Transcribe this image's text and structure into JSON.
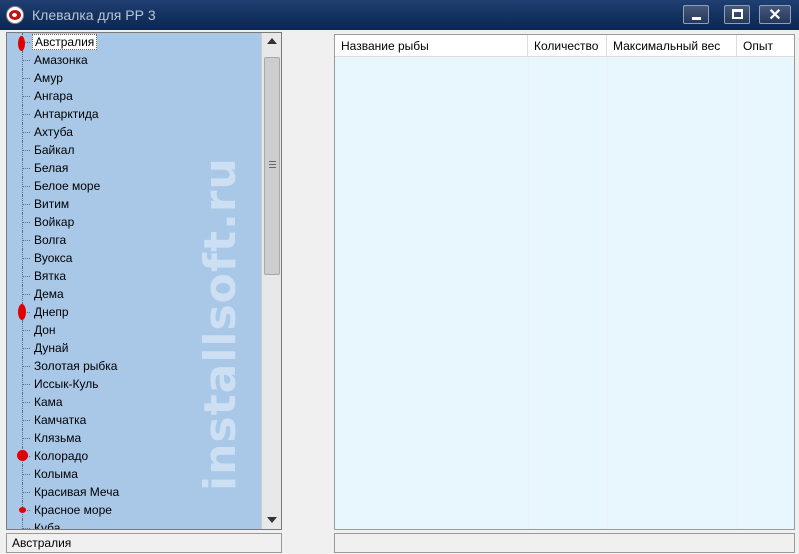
{
  "window": {
    "title": "Клевалка для РР 3",
    "icon": "yin-yang-app-icon",
    "controls": [
      "minimize-icon",
      "maximize-icon",
      "close-icon"
    ],
    "close_glyph": "✕"
  },
  "tree": {
    "selected": "Австралия",
    "items": [
      {
        "label": "Австралия",
        "marked": true
      },
      {
        "label": "Амазонка",
        "marked": false
      },
      {
        "label": "Амур",
        "marked": false
      },
      {
        "label": "Ангара",
        "marked": false
      },
      {
        "label": "Антарктида",
        "marked": false
      },
      {
        "label": "Ахтуба",
        "marked": false
      },
      {
        "label": "Байкал",
        "marked": false
      },
      {
        "label": "Белая",
        "marked": false
      },
      {
        "label": "Белое море",
        "marked": false
      },
      {
        "label": "Витим",
        "marked": false
      },
      {
        "label": "Войкар",
        "marked": false
      },
      {
        "label": "Волга",
        "marked": false
      },
      {
        "label": "Вуокса",
        "marked": false
      },
      {
        "label": "Вятка",
        "marked": false
      },
      {
        "label": "Дема",
        "marked": false
      },
      {
        "label": "Днепр",
        "marked": true
      },
      {
        "label": "Дон",
        "marked": false
      },
      {
        "label": "Дунай",
        "marked": false
      },
      {
        "label": "Золотая рыбка",
        "marked": false
      },
      {
        "label": "Иссык-Куль",
        "marked": false
      },
      {
        "label": "Кама",
        "marked": false
      },
      {
        "label": "Камчатка",
        "marked": false
      },
      {
        "label": "Клязьма",
        "marked": false
      },
      {
        "label": "Колорадо",
        "marked": true
      },
      {
        "label": "Колыма",
        "marked": false
      },
      {
        "label": "Красивая Меча",
        "marked": false
      },
      {
        "label": "Красное море",
        "marked": true
      },
      {
        "label": "Куба",
        "marked": false
      }
    ],
    "watermark": "installsoft.ru",
    "mark_color": "#e00000"
  },
  "grid": {
    "columns": [
      "Название рыбы",
      "Количество",
      "Максимальный вес",
      "Опыт"
    ],
    "rows": []
  },
  "status": {
    "left": "Австралия",
    "right": ""
  }
}
